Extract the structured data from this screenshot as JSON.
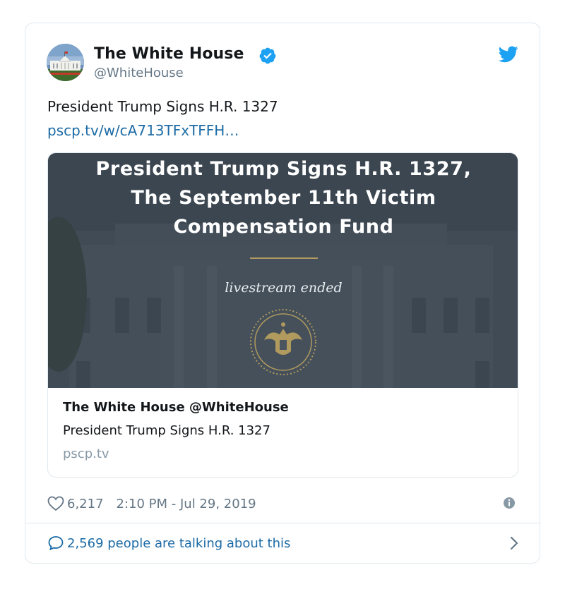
{
  "tweet": {
    "author": {
      "name": "The White House",
      "handle": "@WhiteHouse",
      "verified": true,
      "avatar_icon": "white-house-avatar"
    },
    "text": "President Trump Signs H.R. 1327",
    "link": "pscp.tv/w/cA713TFxTFFH…",
    "card": {
      "media_title_lines": [
        "President Trump Signs H.R. 1327,",
        "The September 11th Victim",
        "Compensation Fund"
      ],
      "media_status": "livestream ended",
      "media_icon": "presidential-seal",
      "heading": "The White House @WhiteHouse",
      "description": "President Trump Signs H.R. 1327",
      "domain": "pscp.tv"
    },
    "likes": "6,217",
    "timestamp": "2:10 PM - Jul 29, 2019",
    "conversation": "2,569 people are talking about this"
  },
  "colors": {
    "link": "#1b6aa5",
    "twitter_blue": "#1da1f2",
    "muted": "#657786",
    "border": "#e1e8ed",
    "card_overlay": "#3a4450",
    "seal_gold": "#b09a5e"
  },
  "icons": {
    "verified": "verified-badge-icon",
    "brand": "twitter-bird-icon",
    "like": "heart-icon",
    "info": "info-icon",
    "reply": "speech-bubble-icon",
    "more": "chevron-right-icon"
  }
}
